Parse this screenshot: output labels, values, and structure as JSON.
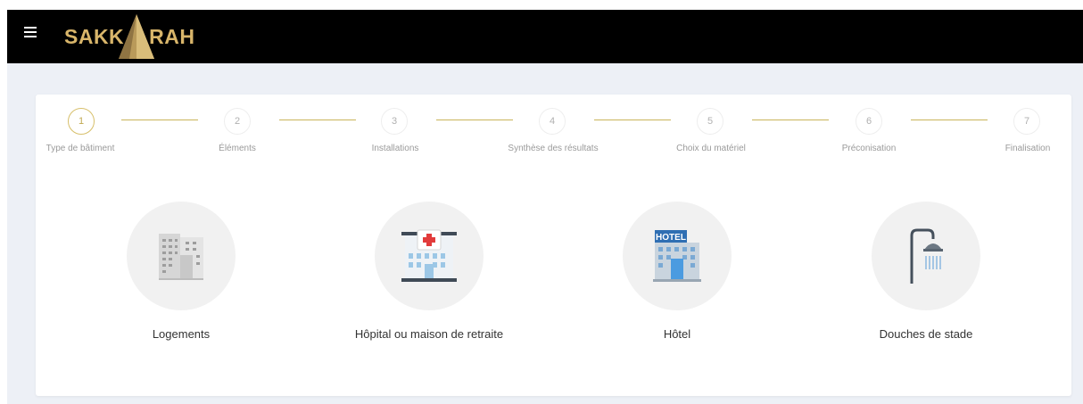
{
  "header": {
    "logo_left": "SAKK",
    "logo_right": "RAH",
    "brand_color": "#d8b56a"
  },
  "stepper": {
    "accent_color": "#d7bf6a",
    "current_step": 1,
    "steps": [
      {
        "number": "1",
        "label": "Type de bâtiment"
      },
      {
        "number": "2",
        "label": "Éléments"
      },
      {
        "number": "3",
        "label": "Installations"
      },
      {
        "number": "4",
        "label": "Synthèse des résultats"
      },
      {
        "number": "5",
        "label": "Choix du matériel"
      },
      {
        "number": "6",
        "label": "Préconisation"
      },
      {
        "number": "7",
        "label": "Finalisation"
      }
    ]
  },
  "building_types": [
    {
      "label": "Logements",
      "icon": "apartment-building-icon"
    },
    {
      "label": "Hôpital ou maison de retraite",
      "icon": "hospital-icon"
    },
    {
      "label": "Hôtel",
      "icon": "hotel-icon",
      "sign": "HOTEL"
    },
    {
      "label": "Douches de stade",
      "icon": "shower-icon"
    }
  ]
}
